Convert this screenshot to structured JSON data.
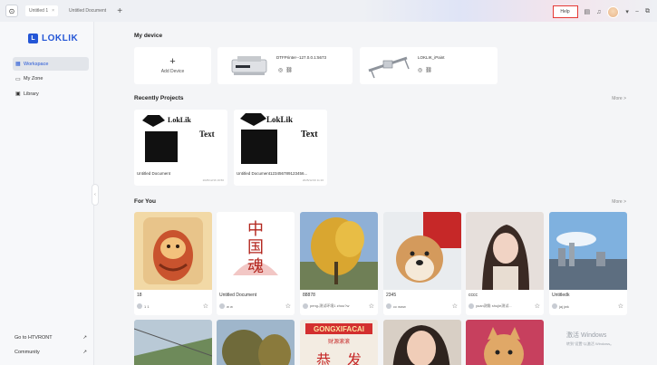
{
  "titlebar": {
    "tabs": [
      {
        "label": "Untitled 1",
        "close": "×"
      },
      {
        "label": "Untitled Document"
      }
    ],
    "add_tab": "+",
    "help": "Help"
  },
  "sidebar": {
    "logo": "LOKLIK",
    "nav": [
      {
        "label": "Workspace",
        "icon": "grid-icon"
      },
      {
        "label": "My Zone",
        "icon": "folder-icon"
      },
      {
        "label": "Library",
        "icon": "library-icon"
      }
    ],
    "bottom": [
      {
        "label": "Go to HTVRONT"
      },
      {
        "label": "Community"
      }
    ]
  },
  "devices": {
    "title": "My device",
    "add_label": "Add Device",
    "items": [
      {
        "name": "DTFPrinter--127.0.0.1:5673"
      },
      {
        "name": "LOKLIK_iPaint"
      }
    ]
  },
  "recent": {
    "title": "Recently Projects",
    "more": "More >",
    "items": [
      {
        "name": "Untitled Document",
        "date": "2025/12/16 19:56",
        "brand": "LokLik",
        "text": "Text"
      },
      {
        "name": "Untitled Document123456789123456...",
        "date": "2025/12/16 11:16",
        "brand": "LokLik",
        "text": "Text"
      }
    ]
  },
  "for_you": {
    "title": "For You",
    "more": "More >",
    "items": [
      {
        "title": "18",
        "user": "1 1"
      },
      {
        "title": "Untitled Document",
        "user": "w w"
      },
      {
        "title": "88878",
        "user": "peng-测试环境1 zhou?w"
      },
      {
        "title": "2345",
        "user": "cc www"
      },
      {
        "title": "cccc",
        "user": "yuan测角 shujie测试..."
      },
      {
        "title": "Untitledk",
        "user": "jaj jwk"
      }
    ],
    "row2_texts": [
      "GONGXIFACAI",
      "财源滚滚",
      "恭",
      "发"
    ]
  },
  "poster_chars": [
    "中",
    "国",
    "魂"
  ],
  "watermark": {
    "line1": "激活 Windows",
    "line2": "转到\"设置\"以激活 Windows。"
  },
  "colors": {
    "brand": "#2456d6",
    "help_border": "#e53935"
  }
}
